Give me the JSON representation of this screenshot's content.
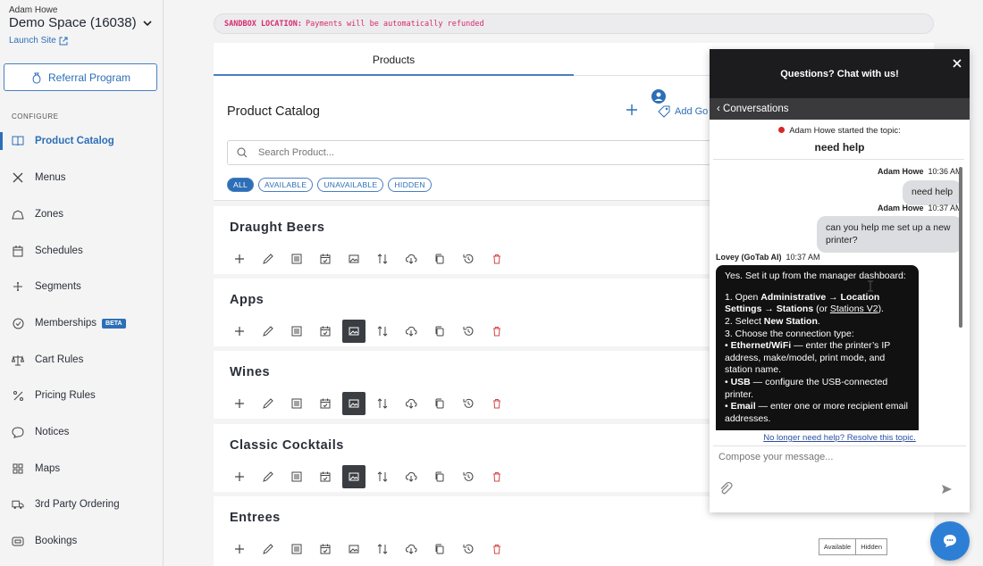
{
  "sidebar": {
    "user_name": "Adam Howe",
    "space_name": "Demo Space (16038)",
    "launch_site": "Launch Site",
    "referral_button": "Referral Program",
    "configure_label": "CONFIGURE",
    "items": [
      {
        "label": "Product Catalog",
        "icon": "book-icon",
        "active": true
      },
      {
        "label": "Menus",
        "icon": "utensils-icon"
      },
      {
        "label": "Zones",
        "icon": "zones-icon"
      },
      {
        "label": "Schedules",
        "icon": "calendar-icon"
      },
      {
        "label": "Segments",
        "icon": "segments-icon"
      },
      {
        "label": "Memberships",
        "icon": "check-circle-icon",
        "badge": "BETA"
      },
      {
        "label": "Cart Rules",
        "icon": "scale-icon"
      },
      {
        "label": "Pricing Rules",
        "icon": "percent-icon"
      },
      {
        "label": "Notices",
        "icon": "chat-bubble-icon"
      },
      {
        "label": "Maps",
        "icon": "grid-icon"
      },
      {
        "label": "3rd Party Ordering",
        "icon": "truck-icon"
      },
      {
        "label": "Bookings",
        "icon": "table-icon"
      }
    ]
  },
  "main": {
    "sandbox_label": "SANDBOX LOCATION:",
    "sandbox_text": "Payments will be automatically refunded",
    "tabs": [
      "Products",
      ""
    ],
    "catalog_title": "Product Catalog",
    "add_go_label": "Add Go",
    "search_placeholder": "Search Product...",
    "filters": [
      "ALL",
      "AVAILABLE",
      "UNAVAILABLE",
      "HIDDEN"
    ],
    "sections": [
      {
        "title": "Draught Beers",
        "image_active": false
      },
      {
        "title": "Apps",
        "image_active": true
      },
      {
        "title": "Wines",
        "image_active": true
      },
      {
        "title": "Classic Cocktails",
        "image_active": true
      },
      {
        "title": "Entrees",
        "image_active": false,
        "pills": [
          "Available",
          "Hidden"
        ]
      }
    ],
    "accent_color": "#2d6fb7"
  },
  "chat": {
    "header": "Questions? Chat with us!",
    "conversations": "Conversations",
    "topic_intro": "Adam Howe started the topic:",
    "topic_name": "need help",
    "messages": [
      {
        "author": "Adam Howe",
        "time": "10:36 AM",
        "text": "need help"
      },
      {
        "author": "Adam Howe",
        "time": "10:37 AM",
        "text": "can you help me set up a new printer?"
      }
    ],
    "ai_author": "Lovey (GoTab AI)",
    "ai_time": "10:37 AM",
    "ai_intro": "Yes. Set it up from the manager dashboard:",
    "ai_steps": {
      "s1_pre": "1. Open ",
      "s1_bold1": "Administrative → Location Settings → Stations",
      "s1_mid": " (or ",
      "s1_link": "Stations V2",
      "s1_end": ").",
      "s2_pre": "2. Select ",
      "s2_bold": "New Station",
      "s2_end": ".",
      "s3": "3. Choose the connection type:",
      "b1_bold": "Ethernet/WiFi",
      "b1_text": " — enter the printer’s IP address, make/model, print mode, and station name.",
      "b2_bold": "USB",
      "b2_text": " — configure the USB-connected printer.",
      "b3_bold": "Email",
      "b3_text": " — enter one or more recipient email addresses."
    },
    "resolve_link": "No longer need help? Resolve this topic.",
    "compose_placeholder": "Compose your message..."
  }
}
